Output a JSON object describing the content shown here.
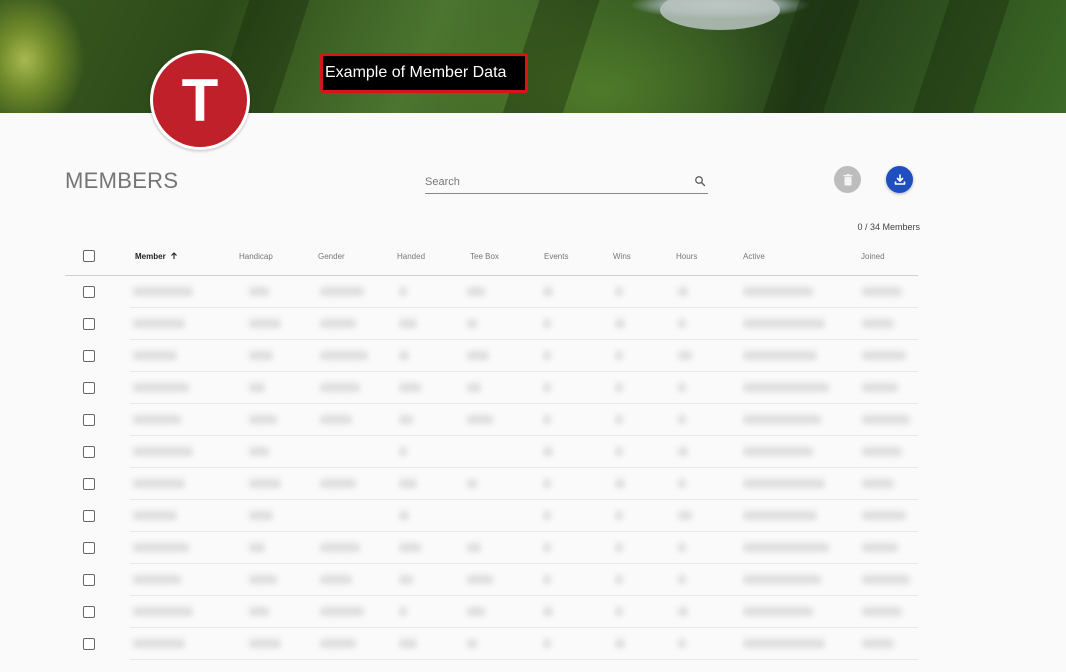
{
  "caption": "Example of Member Data",
  "avatar_letter": "T",
  "page_title": "MEMBERS",
  "search": {
    "placeholder": "Search"
  },
  "member_count": "0 / 34 Members",
  "columns": [
    "Member",
    "Handicap",
    "Gender",
    "Handed",
    "Tee Box",
    "Events",
    "Wins",
    "Hours",
    "Active",
    "Joined"
  ],
  "sorted_column": "Member",
  "row_count": 12,
  "colors": {
    "accent": "#1f4fbf",
    "avatar": "#c0202a",
    "caption_border": "#d61616"
  },
  "icons": [
    "search-icon",
    "delete-icon",
    "download-icon",
    "arrow-up-icon",
    "checkbox-icon"
  ]
}
